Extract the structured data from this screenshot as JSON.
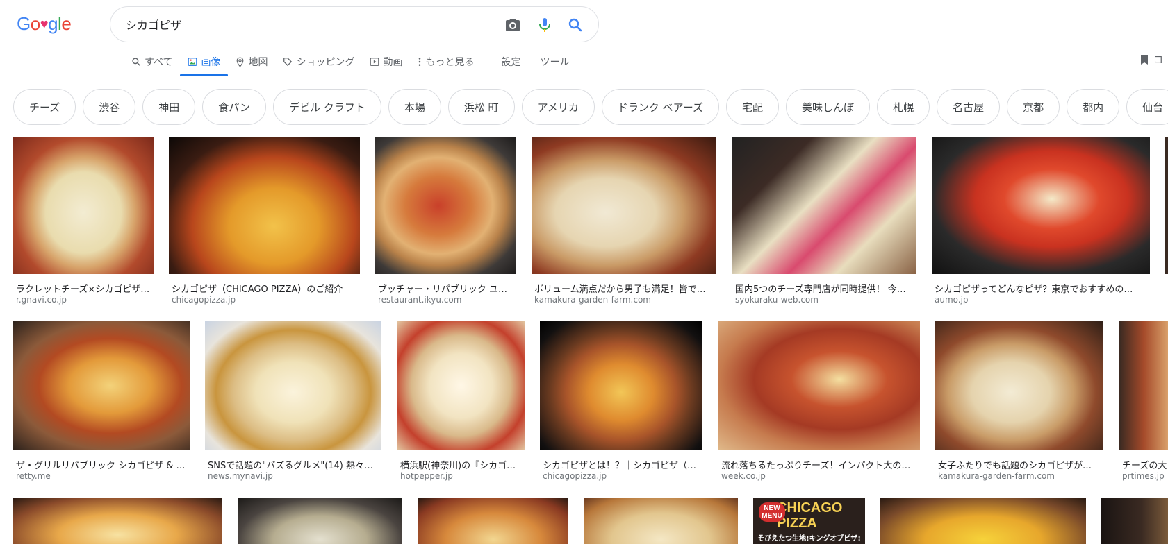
{
  "search": {
    "query": "シカゴピザ"
  },
  "tabs": [
    {
      "label": "すべて"
    },
    {
      "label": "画像"
    },
    {
      "label": "地図"
    },
    {
      "label": "ショッピング"
    },
    {
      "label": "動画"
    },
    {
      "label": "もっと見る"
    },
    {
      "label": "設定"
    },
    {
      "label": "ツール"
    }
  ],
  "right_tool_label": "コ",
  "chips": [
    "チーズ",
    "渋谷",
    "神田",
    "食パン",
    "デビル クラフト",
    "本場",
    "浜松 町",
    "アメリカ",
    "ドランク ベアーズ",
    "宅配",
    "美味しんぼ",
    "札幌",
    "名古屋",
    "京都",
    "都内",
    "仙台"
  ],
  "results_row1": [
    {
      "caption": "ラクレットチーズ×シカゴピザ…",
      "source": "r.gnavi.co.jp"
    },
    {
      "caption": "シカゴピザ（CHICAGO PIZZA）のご紹介",
      "source": "chicagopizza.jp"
    },
    {
      "caption": "ブッチャー・リパブリック ユ…",
      "source": "restaurant.ikyu.com"
    },
    {
      "caption": "ボリューム満点だから男子も満足！皆で…",
      "source": "kamakura-garden-farm.com"
    },
    {
      "caption": "国内5つのチーズ専門店が同時提供！ 今…",
      "source": "syokuraku-web.com"
    },
    {
      "caption": "シカゴピザってどんなピザ？東京でおすすめの…",
      "source": "aumo.jp"
    }
  ],
  "results_row2": [
    {
      "caption": "ザ・グリルリパブリック シカゴピザ & …",
      "source": "retty.me"
    },
    {
      "caption": "SNSで話題の\"バズるグルメ\"(14) 熱々！…",
      "source": "news.mynavi.jp"
    },
    {
      "caption": "横浜駅(神奈川)の『シカゴ…",
      "source": "hotpepper.jp"
    },
    {
      "caption": "シカゴピザとは！？｜シカゴピザ（…",
      "source": "chicagopizza.jp"
    },
    {
      "caption": "流れ落ちるたっぷりチーズ！インパクト大の…",
      "source": "week.co.jp"
    },
    {
      "caption": "女子ふたりでも話題のシカゴピザが…",
      "source": "kamakura-garden-farm.com"
    },
    {
      "caption": "チーズの大",
      "source": "prtimes.jp"
    }
  ],
  "row3_banner": {
    "badge": "NEW MENU",
    "title": "CHICAGO PIZZA",
    "subtitle": "そびえたつ生地!キングオブピザ!"
  }
}
